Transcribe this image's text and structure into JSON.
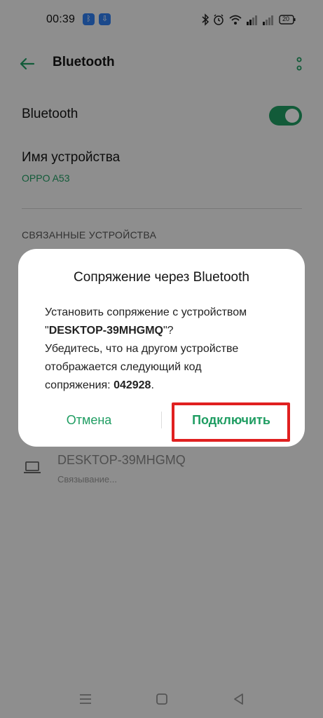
{
  "status_bar": {
    "time": "00:39",
    "badge_1": "ᛒ",
    "badge_2": "⇩",
    "battery": "20"
  },
  "app_bar": {
    "title": "Bluetooth"
  },
  "settings": {
    "bluetooth_label": "Bluetooth",
    "bluetooth_enabled": true,
    "device_name_label": "Имя устройства",
    "device_name_value": "OPPO A53",
    "section_header": "СВЯЗАННЫЕ УСТРОЙСТВА"
  },
  "device": {
    "name": "DESKTOP-39MHGMQ",
    "status": "Связывание..."
  },
  "dialog": {
    "title": "Сопряжение через Bluetooth",
    "body_line1": "Установить сопряжение с устройством",
    "body_quote_open": "\"",
    "body_device": "DESKTOP-39MHGMQ",
    "body_quote_close": "\"?",
    "body_line3": "Убедитесь, что на другом устройстве",
    "body_line4": "отображается следующий код",
    "body_line5_prefix": "сопряжения: ",
    "code": "042928",
    "body_line5_suffix": ".",
    "cancel_label": "Отмена",
    "connect_label": "Подключить"
  },
  "colors": {
    "accent": "#1f9d62",
    "highlight": "#e02020"
  }
}
